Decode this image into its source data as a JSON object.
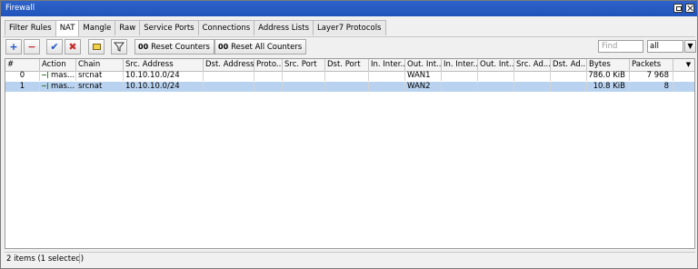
{
  "window": {
    "title": "Firewall"
  },
  "tabs": [
    {
      "label": "Filter Rules",
      "active": false
    },
    {
      "label": "NAT",
      "active": true
    },
    {
      "label": "Mangle",
      "active": false
    },
    {
      "label": "Raw",
      "active": false
    },
    {
      "label": "Service Ports",
      "active": false
    },
    {
      "label": "Connections",
      "active": false
    },
    {
      "label": "Address Lists",
      "active": false
    },
    {
      "label": "Layer7 Protocols",
      "active": false
    }
  ],
  "toolbar": {
    "add_icon": "plus-icon",
    "remove_icon": "minus-icon",
    "enable_icon": "check-icon",
    "disable_icon": "x-icon",
    "comment_icon": "note-icon",
    "filter_icon": "funnel-icon",
    "reset_counters": "Reset Counters",
    "reset_all_counters": "Reset All Counters",
    "counter_glyph": "00",
    "find_placeholder": "Find",
    "filter_value": "all",
    "colors": {
      "add": "#1f4fc4",
      "remove": "#c43030",
      "enable": "#1f4fc4",
      "disable": "#c43030",
      "comment": "#f2d14a"
    }
  },
  "table": {
    "columns": [
      "#",
      "Action",
      "Chain",
      "Src. Address",
      "Dst. Address",
      "Proto...",
      "Src. Port",
      "Dst. Port",
      "In. Inter...",
      "Out. Int...",
      "In. Inter...",
      "Out. Int...",
      "Src. Ad...",
      "Dst. Ad...",
      "Bytes",
      "Packets"
    ],
    "rows": [
      {
        "index": "0",
        "action": "mas...",
        "chain": "srcnat",
        "src_address": "10.10.10.0/24",
        "dst_address": "",
        "protocol": "",
        "src_port": "",
        "dst_port": "",
        "in_interface": "",
        "out_interface": "WAN1",
        "in_interface_list": "",
        "out_interface_list": "",
        "src_address_list": "",
        "dst_address_list": "",
        "bytes": "786.0 KiB",
        "packets": "7 968",
        "selected": false
      },
      {
        "index": "1",
        "action": "mas...",
        "chain": "srcnat",
        "src_address": "10.10.10.0/24",
        "dst_address": "",
        "protocol": "",
        "src_port": "",
        "dst_port": "",
        "in_interface": "",
        "out_interface": "WAN2",
        "in_interface_list": "",
        "out_interface_list": "",
        "src_address_list": "",
        "dst_address_list": "",
        "bytes": "10.8 KiB",
        "packets": "8",
        "selected": true
      }
    ],
    "selected_color": "#b8d2f0"
  },
  "status": {
    "text": "2 items (1 selected)"
  }
}
